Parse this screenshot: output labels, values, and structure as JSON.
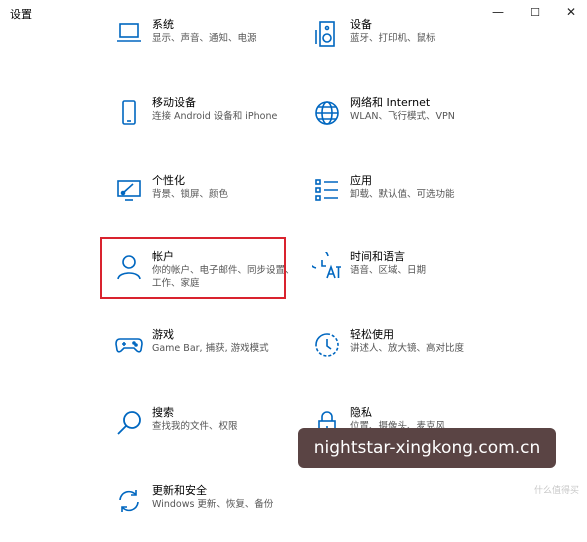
{
  "window": {
    "title": "设置",
    "minimize": "—",
    "maximize": "☐",
    "close": "✕"
  },
  "accent": "#0067c0",
  "tiles": [
    {
      "id": "system",
      "name": "系统",
      "desc": "显示、声音、通知、电源",
      "icon": "laptop-icon"
    },
    {
      "id": "devices",
      "name": "设备",
      "desc": "蓝牙、打印机、鼠标",
      "icon": "keyboard-speaker-icon"
    },
    {
      "id": "phone",
      "name": "移动设备",
      "desc": "连接 Android 设备和 iPhone",
      "icon": "phone-icon"
    },
    {
      "id": "network",
      "name": "网络和 Internet",
      "desc": "WLAN、飞行模式、VPN",
      "icon": "globe-icon"
    },
    {
      "id": "personalization",
      "name": "个性化",
      "desc": "背景、锁屏、颜色",
      "icon": "paint-monitor-icon"
    },
    {
      "id": "apps",
      "name": "应用",
      "desc": "卸载、默认值、可选功能",
      "icon": "apps-list-icon"
    },
    {
      "id": "accounts",
      "name": "帐户",
      "desc": "你的帐户、电子邮件、同步设置、工作、家庭",
      "icon": "person-icon"
    },
    {
      "id": "time",
      "name": "时间和语言",
      "desc": "语音、区域、日期",
      "icon": "language-icon"
    },
    {
      "id": "gaming",
      "name": "游戏",
      "desc": "Game Bar, 捕获, 游戏模式",
      "icon": "gamepad-icon"
    },
    {
      "id": "ease",
      "name": "轻松使用",
      "desc": "讲述人、放大镜、高对比度",
      "icon": "ease-of-access-icon"
    },
    {
      "id": "search",
      "name": "搜索",
      "desc": "查找我的文件、权限",
      "icon": "search-icon"
    },
    {
      "id": "privacy",
      "name": "隐私",
      "desc": "位置、摄像头、麦克风",
      "icon": "lock-icon"
    },
    {
      "id": "update",
      "name": "更新和安全",
      "desc": "Windows 更新、恢复、备份",
      "icon": "refresh-icon"
    }
  ],
  "watermark": {
    "text": "nightstar-xingkong.com.cn",
    "small": "什么值得买"
  }
}
